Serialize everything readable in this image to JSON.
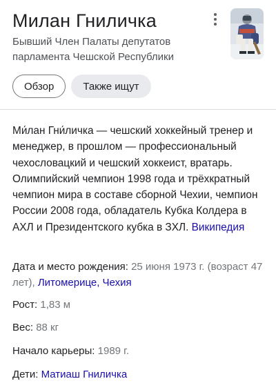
{
  "header": {
    "title": "Милан Гниличка",
    "subtitle": "Бывший Член Палаты депутатов парламента Чешской Республики",
    "more_icon": "more-vert-icon"
  },
  "chips": [
    {
      "label": "Обзор"
    },
    {
      "label": "Также ищут"
    }
  ],
  "description": {
    "text": "Ми́лан Гни́личка — чешский хоккейный тренер и менеджер, в прошлом — профессиональный чехословацкий и чешский хоккеист, вратарь. Олимпийский чемпион 1998 года и трёхкратный чемпион мира в составе сборной Чехии, чемпион России 2008 года, обладатель Кубка Колдера в АХЛ и Президентского кубка в ЗХЛ.",
    "source": "Википедия"
  },
  "facts": {
    "birth": {
      "label": "Дата и место рождения:",
      "value": "25 июня 1973 г. (возраст 47 лет),",
      "link": "Литомерице, Чехия"
    },
    "height": {
      "label": "Рост:",
      "value": "1,83 м"
    },
    "weight": {
      "label": "Вес:",
      "value": "88 кг"
    },
    "career": {
      "label": "Начало карьеры:",
      "value": "1989 г."
    },
    "children": {
      "label": "Дети:",
      "link": "Матиаш Гниличка"
    }
  },
  "colors": {
    "link": "#1a0dab",
    "muted": "#70757a",
    "text": "#202124"
  }
}
